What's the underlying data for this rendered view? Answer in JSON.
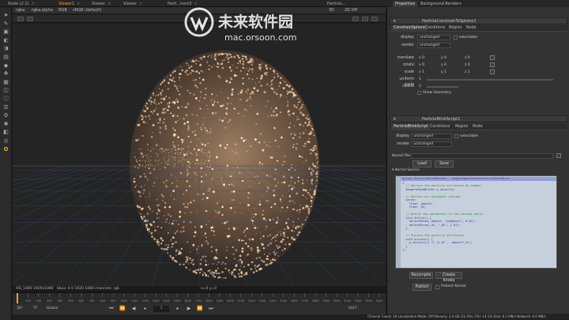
{
  "top_tabs": [
    {
      "label": "Node (2.1)",
      "active": false
    },
    {
      "label": "Viewer1",
      "active": true
    },
    {
      "label": "Viewer",
      "active": false
    },
    {
      "label": "Viewer",
      "active": false
    },
    {
      "label": "Parti...here3",
      "active": false
    },
    {
      "label": "Particle...",
      "active": false
    }
  ],
  "viewer_toolbar": {
    "layer": "rgba",
    "layer_sub": "rgba.alpha",
    "channel": "RGB",
    "colorspace": "sRGB (default)",
    "view_mode": "3D",
    "overlay": "2D Off"
  },
  "viewer_info": {
    "format": "HD_1080 1920x1080",
    "bbox": "bbox: 0 0 1920 1080 channels: rgb",
    "coords": "x=0 y=0"
  },
  "timeline": {
    "frame_in": "1",
    "frame_out": "3447",
    "tick_labels": [
      "1",
      "100",
      "200",
      "300",
      "400",
      "500",
      "600",
      "700",
      "800",
      "900",
      "1000",
      "1100",
      "1200",
      "1300",
      "1400",
      "1500",
      "1600",
      "1700",
      "1800",
      "1900",
      "2000",
      "2100",
      "2200",
      "2300",
      "2400",
      "2500",
      "2600",
      "2700",
      "2800",
      "2900",
      "3000",
      "3100",
      "3200",
      "3300",
      "3447"
    ],
    "fps": "30*",
    "tf": "TF",
    "global": "Global",
    "current_frame": "1",
    "end_frame": "3447"
  },
  "right_tabs": [
    {
      "label": "Properties",
      "active": true
    },
    {
      "label": "Background Renders",
      "active": false
    }
  ],
  "node1": {
    "title": "ParticleConstrainToSphere1",
    "tabs": [
      "ConstrainSphere",
      "Conditions",
      "Region",
      "Node"
    ],
    "display_label": "display",
    "display_value": "unchanged",
    "selectable_label": "selectable",
    "render_label": "render",
    "render_value": "unchanged",
    "translate_label": "translate",
    "translate": [
      "x 0",
      "y 0",
      "z 0"
    ],
    "rotate_label": "rotate",
    "rotate": [
      "x 0",
      "y 0",
      "z 0"
    ],
    "scale_label": "scale",
    "scale": [
      "x 1",
      "y 1",
      "z 1"
    ],
    "uniform_scale_label": "uniform scale",
    "uniform_scale": "1",
    "radius_label": "radius",
    "radius": "2",
    "show_geometry_label": "Show Geometry"
  },
  "node2": {
    "title": "ParticleBlinkScript1",
    "tabs": [
      "ParticleBlinkScript",
      "Conditions",
      "Region",
      "Node"
    ],
    "display_label": "display",
    "display_value": "unchanged",
    "selectable_label": "selectable",
    "render_label": "render",
    "render_value": "unchanged",
    "kernel_file_label": "Kernel File",
    "load_label": "Load",
    "save_label": "Save",
    "kernel_source_label": "Kernel Source",
    "code": [
      {
        "t": "kernel ParticleBlinkKernel : ImageComputationKernel<ePixelWise>",
        "c": "kw"
      },
      {
        "t": "{",
        "c": ""
      },
      {
        "t": "  // Declare the particle attributes as Images",
        "c": "cm"
      },
      {
        "t": "  Image<eReadWrite> p_velocity;",
        "c": ""
      },
      {
        "t": "",
        "c": ""
      },
      {
        "t": "  // Declare our parameter storage",
        "c": "cm"
      },
      {
        "t": "  param:",
        "c": "kw"
      },
      {
        "t": "    float _amount;",
        "c": ""
      },
      {
        "t": "    float _dt;",
        "c": ""
      },
      {
        "t": "",
        "c": ""
      },
      {
        "t": "  // Define the parameters to the outside world",
        "c": "cm"
      },
      {
        "t": "  void define() {",
        "c": "kw"
      },
      {
        "t": "    defineParam(_amount, \"paAmount\", 0.0f);",
        "c": ""
      },
      {
        "t": "    defineParam(_dt, \"_dt\", 1.0f);",
        "c": ""
      },
      {
        "t": "  }",
        "c": ""
      },
      {
        "t": "",
        "c": ""
      },
      {
        "t": "  // Process the particle attributes",
        "c": "cm"
      },
      {
        "t": "  void process() {",
        "c": "kw"
      },
      {
        "t": "    p_velocity() *= (1.0f - _amount*_dt);",
        "c": ""
      },
      {
        "t": "  }",
        "c": ""
      },
      {
        "t": "};",
        "c": ""
      }
    ],
    "recompile_label": "Recompile",
    "create_knobs_label": "Create Knobs",
    "publish_label": "Publish",
    "protect_kernel_label": "Protect Kernel"
  },
  "statusbar": "Channel Count: 10  Localization Mode: Off  Memory: 3.4 GB (21.0%)  CPU: 14.1%  Disk: 8.2 MB/s  Network: 0.0 MB/s",
  "watermark": {
    "brand": "未来软件园",
    "url": "mac.orsoon.com"
  },
  "colors": {
    "accent": "#f0a030",
    "particle": "#ffd9b0",
    "panel": "#333333",
    "code_bg": "#c6cfdc"
  },
  "icons": [
    "cursor-icon",
    "paint-icon",
    "crop-icon",
    "merge-icon",
    "color-icon",
    "filter-icon",
    "keyer-icon",
    "transform-icon",
    "3d-icon",
    "views-icon",
    "metadata-icon",
    "toolsets-icon",
    "other-icon",
    "particles-icon",
    "deep-icon",
    "furnace-icon",
    "nuke-logo-icon"
  ]
}
